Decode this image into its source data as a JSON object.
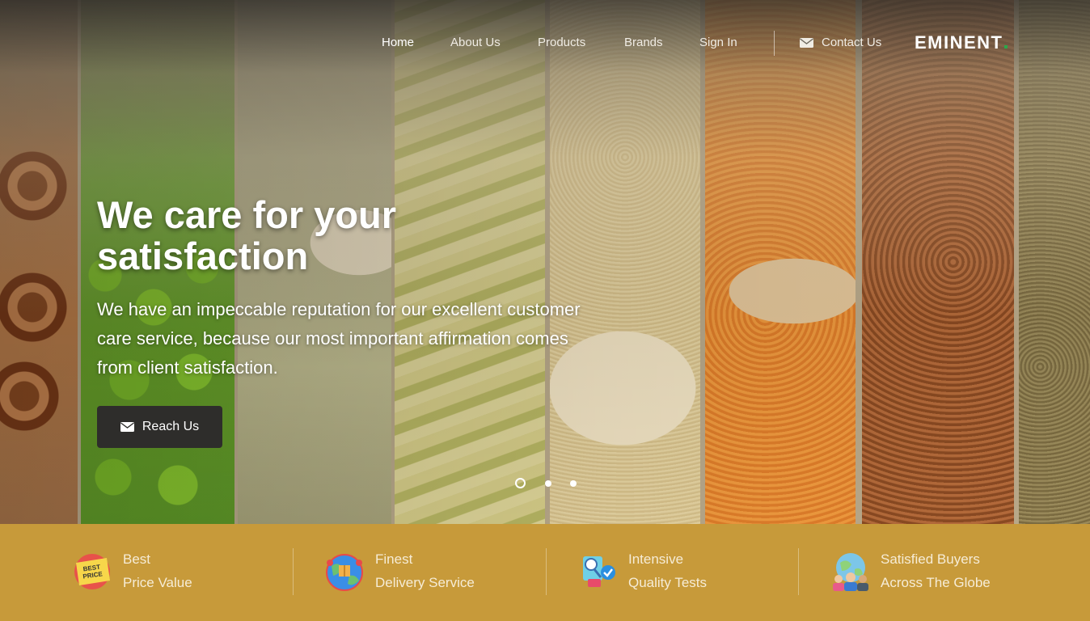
{
  "nav": {
    "items": [
      {
        "label": "Home",
        "active": true
      },
      {
        "label": "About Us",
        "active": false
      },
      {
        "label": "Products",
        "active": false
      },
      {
        "label": "Brands",
        "active": false
      },
      {
        "label": "Sign In",
        "active": false
      }
    ],
    "contact_label": "Contact Us",
    "contact_icon": "envelope-icon",
    "logo_text": "EMINENT"
  },
  "hero": {
    "headline": "We care for your satisfaction",
    "subtext": "We have an impeccable reputation for our excellent customer care service, because our most important affirmation comes from client satisfaction.",
    "cta_label": "Reach Us",
    "cta_icon": "envelope-icon",
    "slides_total": 3,
    "active_slide": 1
  },
  "features": [
    {
      "line1": "Best",
      "line2": "Price Value",
      "icon": "best-price-tag-icon",
      "icon_text": "BEST PRICE"
    },
    {
      "line1": "Finest",
      "line2": "Delivery Service",
      "icon": "globe-delivery-icon"
    },
    {
      "line1": "Intensive",
      "line2": "Quality Tests",
      "icon": "quality-test-icon"
    },
    {
      "line1": "Satisfied Buyers",
      "line2": "Across The Globe",
      "icon": "satisfied-buyers-icon"
    }
  ],
  "colors": {
    "feature_bar": "#c79a3a",
    "cta_background": "#2e2d2b",
    "logo_accent": "#2aa84a"
  }
}
